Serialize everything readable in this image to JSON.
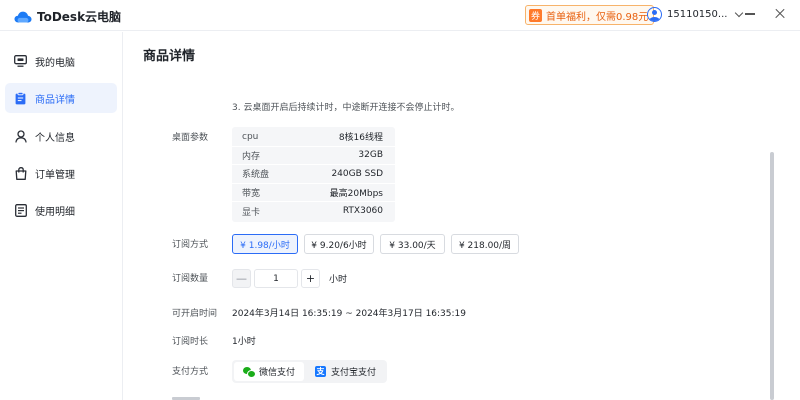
{
  "app": {
    "name": "ToDesk云电脑"
  },
  "titlebar": {
    "promo_icon": "券",
    "promo_text": "首单福利，仅需0.98元",
    "username": "15110150..."
  },
  "sidebar": {
    "items": [
      {
        "label": "我的电脑",
        "icon": "monitor-icon",
        "active": false
      },
      {
        "label": "商品详情",
        "icon": "clipboard-icon",
        "active": true
      },
      {
        "label": "个人信息",
        "icon": "person-icon",
        "active": false
      },
      {
        "label": "订单管理",
        "icon": "bag-icon",
        "active": false
      },
      {
        "label": "使用明细",
        "icon": "detail-list-icon",
        "active": false
      }
    ]
  },
  "main": {
    "title": "商品详情",
    "note": "3. 云桌面开启后持续计时，中途断开连接不会停止计时。",
    "specs_label": "桌面参数",
    "specs": [
      {
        "key": "cpu",
        "value": "8核16线程"
      },
      {
        "key": "内存",
        "value": "32GB"
      },
      {
        "key": "系统盘",
        "value": "240GB SSD"
      },
      {
        "key": "带宽",
        "value": "最高20Mbps"
      },
      {
        "key": "显卡",
        "value": "RTX3060"
      }
    ],
    "plan_label": "订阅方式",
    "plans": [
      {
        "label": "¥ 1.98/小时",
        "selected": true
      },
      {
        "label": "¥ 9.20/6小时",
        "selected": false
      },
      {
        "label": "¥ 33.00/天",
        "selected": false
      },
      {
        "label": "¥ 218.00/周",
        "selected": false
      }
    ],
    "quantity_label": "订阅数量",
    "quantity": {
      "minus": "—",
      "value": "1",
      "plus": "+",
      "unit": "小时"
    },
    "available_label": "可开启时间",
    "available_time": "2024年3月14日 16:35:19 ~ 2024年3月17日 16:35:19",
    "duration_label": "订阅时长",
    "duration": "1小时",
    "payment_label": "支付方式",
    "payment": [
      {
        "label": "微信支付",
        "icon": "wechat-pay-icon",
        "selected": true
      },
      {
        "label": "支付宝支付",
        "icon": "alipay-icon",
        "selected": false
      }
    ]
  }
}
